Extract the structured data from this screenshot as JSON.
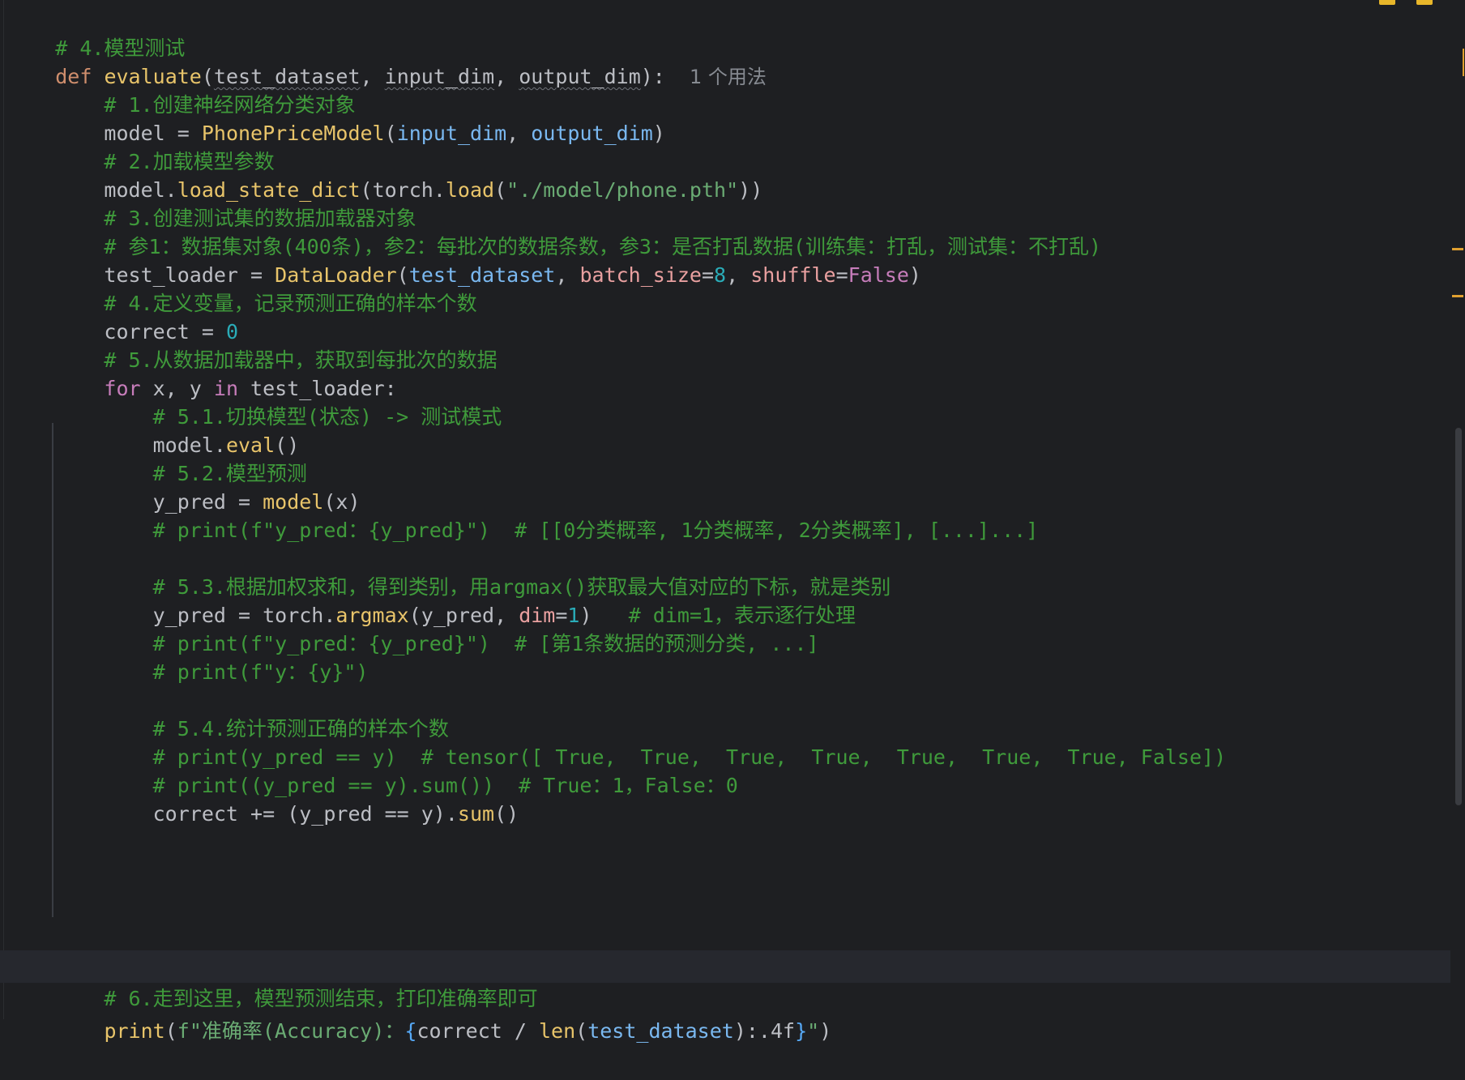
{
  "editor": {
    "language": "python",
    "usage_hint": "1 个用法",
    "lines": {
      "l1": "# 4.模型测试",
      "l2_def": "def",
      "l2_name": "evaluate",
      "l2_open": "(",
      "l2_p1": "test_dataset",
      "l2_sep1": ", ",
      "l2_p2": "input_dim",
      "l2_sep2": ", ",
      "l2_p3": "output_dim",
      "l2_close": "):",
      "l3": "    # 1.创建神经网络分类对象",
      "l4_a": "    model = ",
      "l4_cls": "PhonePriceModel",
      "l4_o": "(",
      "l4_p1": "input_dim",
      "l4_s": ", ",
      "l4_p2": "output_dim",
      "l4_c": ")",
      "l5": "    # 2.加载模型参数",
      "l6_a": "    model.",
      "l6_m": "load_state_dict",
      "l6_b": "(torch.",
      "l6_m2": "load",
      "l6_c": "(",
      "l6_str": "\"./model/phone.pth\"",
      "l6_d": "))",
      "l7": "    # 3.创建测试集的数据加载器对象",
      "l8": "    # 参1：数据集对象(400条)，参2：每批次的数据条数，参3：是否打乱数据(训练集：打乱，测试集：不打乱)",
      "l9_a": "    test_loader = ",
      "l9_cls": "DataLoader",
      "l9_o": "(",
      "l9_p": "test_dataset",
      "l9_s1": ", ",
      "l9_k1": "batch_size",
      "l9_eq1": "=",
      "l9_v1": "8",
      "l9_s2": ", ",
      "l9_k2": "shuffle",
      "l9_eq2": "=",
      "l9_v2": "False",
      "l9_c": ")",
      "l10": "    # 4.定义变量，记录预测正确的样本个数",
      "l11_a": "    correct = ",
      "l11_v": "0",
      "l12": "    # 5.从数据加载器中，获取到每批次的数据",
      "l13_kw": "    for",
      "l13_a": " x, y ",
      "l13_in": "in",
      "l13_b": " test_loader:",
      "l14": "        # 5.1.切换模型(状态) -> 测试模式",
      "l15_a": "        model.",
      "l15_m": "eval",
      "l15_b": "()",
      "l16": "        # 5.2.模型预测",
      "l17_a": "        y_pred = ",
      "l17_m": "model",
      "l17_b": "(x)",
      "l18": "        # print(f\"y_pred：{y_pred}\")  # [[0分类概率, 1分类概率, 2分类概率], [...]...]",
      "l20": "        # 5.3.根据加权求和，得到类别，用argmax()获取最大值对应的下标，就是类别",
      "l21_a": "        y_pred = torch.",
      "l21_m": "argmax",
      "l21_b": "(y_pred, ",
      "l21_k": "dim",
      "l21_eq": "=",
      "l21_v": "1",
      "l21_c": ")   ",
      "l21_cmt": "# dim=1，表示逐行处理",
      "l22": "        # print(f\"y_pred：{y_pred}\")  # [第1条数据的预测分类, ...]",
      "l23": "        # print(f\"y：{y}\")",
      "l25": "        # 5.4.统计预测正确的样本个数",
      "l26": "        # print(y_pred == y)  # tensor([ True,  True,  True,  True,  True,  True,  True, False])",
      "l27": "        # print((y_pred == y).sum())  # True：1，False：0",
      "l28_a": "        correct += (y_pred == y).",
      "l28_m": "sum",
      "l28_b": "()",
      "l30": "    # 6.走到这里，模型预测结束，打印准确率即可",
      "l31_a": "    ",
      "l31_fn": "print",
      "l31_o": "(",
      "l31_f": "f\"准确率(Accuracy)：",
      "l31_br1": "{",
      "l31_expr": "correct / ",
      "l31_len": "len",
      "l31_lo": "(",
      "l31_arg": "test_dataset",
      "l31_lc": ")",
      "l31_fmt": ":.4f",
      "l31_br2": "}",
      "l31_end": "\"",
      "l31_c": ")"
    }
  },
  "colors": {
    "background": "#1e1f22",
    "comment": "#3f9a3b",
    "keyword": "#cf8e6d",
    "string": "#6aab73",
    "number": "#2aacb8",
    "warning_stripe": "#e0a030"
  }
}
